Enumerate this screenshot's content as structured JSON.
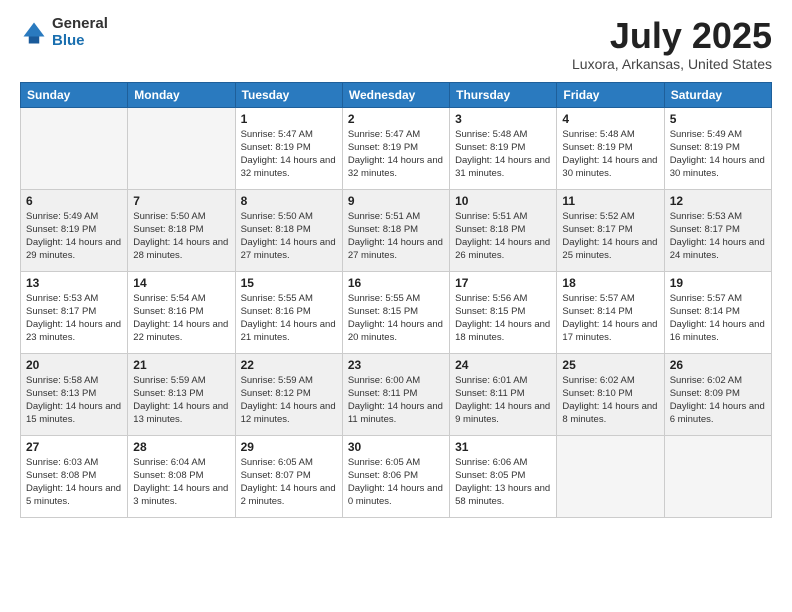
{
  "logo": {
    "general": "General",
    "blue": "Blue"
  },
  "title": "July 2025",
  "location": "Luxora, Arkansas, United States",
  "days_of_week": [
    "Sunday",
    "Monday",
    "Tuesday",
    "Wednesday",
    "Thursday",
    "Friday",
    "Saturday"
  ],
  "weeks": [
    [
      {
        "day": "",
        "info": ""
      },
      {
        "day": "",
        "info": ""
      },
      {
        "day": "1",
        "sunrise": "Sunrise: 5:47 AM",
        "sunset": "Sunset: 8:19 PM",
        "daylight": "Daylight: 14 hours and 32 minutes."
      },
      {
        "day": "2",
        "sunrise": "Sunrise: 5:47 AM",
        "sunset": "Sunset: 8:19 PM",
        "daylight": "Daylight: 14 hours and 32 minutes."
      },
      {
        "day": "3",
        "sunrise": "Sunrise: 5:48 AM",
        "sunset": "Sunset: 8:19 PM",
        "daylight": "Daylight: 14 hours and 31 minutes."
      },
      {
        "day": "4",
        "sunrise": "Sunrise: 5:48 AM",
        "sunset": "Sunset: 8:19 PM",
        "daylight": "Daylight: 14 hours and 30 minutes."
      },
      {
        "day": "5",
        "sunrise": "Sunrise: 5:49 AM",
        "sunset": "Sunset: 8:19 PM",
        "daylight": "Daylight: 14 hours and 30 minutes."
      }
    ],
    [
      {
        "day": "6",
        "sunrise": "Sunrise: 5:49 AM",
        "sunset": "Sunset: 8:19 PM",
        "daylight": "Daylight: 14 hours and 29 minutes."
      },
      {
        "day": "7",
        "sunrise": "Sunrise: 5:50 AM",
        "sunset": "Sunset: 8:18 PM",
        "daylight": "Daylight: 14 hours and 28 minutes."
      },
      {
        "day": "8",
        "sunrise": "Sunrise: 5:50 AM",
        "sunset": "Sunset: 8:18 PM",
        "daylight": "Daylight: 14 hours and 27 minutes."
      },
      {
        "day": "9",
        "sunrise": "Sunrise: 5:51 AM",
        "sunset": "Sunset: 8:18 PM",
        "daylight": "Daylight: 14 hours and 27 minutes."
      },
      {
        "day": "10",
        "sunrise": "Sunrise: 5:51 AM",
        "sunset": "Sunset: 8:18 PM",
        "daylight": "Daylight: 14 hours and 26 minutes."
      },
      {
        "day": "11",
        "sunrise": "Sunrise: 5:52 AM",
        "sunset": "Sunset: 8:17 PM",
        "daylight": "Daylight: 14 hours and 25 minutes."
      },
      {
        "day": "12",
        "sunrise": "Sunrise: 5:53 AM",
        "sunset": "Sunset: 8:17 PM",
        "daylight": "Daylight: 14 hours and 24 minutes."
      }
    ],
    [
      {
        "day": "13",
        "sunrise": "Sunrise: 5:53 AM",
        "sunset": "Sunset: 8:17 PM",
        "daylight": "Daylight: 14 hours and 23 minutes."
      },
      {
        "day": "14",
        "sunrise": "Sunrise: 5:54 AM",
        "sunset": "Sunset: 8:16 PM",
        "daylight": "Daylight: 14 hours and 22 minutes."
      },
      {
        "day": "15",
        "sunrise": "Sunrise: 5:55 AM",
        "sunset": "Sunset: 8:16 PM",
        "daylight": "Daylight: 14 hours and 21 minutes."
      },
      {
        "day": "16",
        "sunrise": "Sunrise: 5:55 AM",
        "sunset": "Sunset: 8:15 PM",
        "daylight": "Daylight: 14 hours and 20 minutes."
      },
      {
        "day": "17",
        "sunrise": "Sunrise: 5:56 AM",
        "sunset": "Sunset: 8:15 PM",
        "daylight": "Daylight: 14 hours and 18 minutes."
      },
      {
        "day": "18",
        "sunrise": "Sunrise: 5:57 AM",
        "sunset": "Sunset: 8:14 PM",
        "daylight": "Daylight: 14 hours and 17 minutes."
      },
      {
        "day": "19",
        "sunrise": "Sunrise: 5:57 AM",
        "sunset": "Sunset: 8:14 PM",
        "daylight": "Daylight: 14 hours and 16 minutes."
      }
    ],
    [
      {
        "day": "20",
        "sunrise": "Sunrise: 5:58 AM",
        "sunset": "Sunset: 8:13 PM",
        "daylight": "Daylight: 14 hours and 15 minutes."
      },
      {
        "day": "21",
        "sunrise": "Sunrise: 5:59 AM",
        "sunset": "Sunset: 8:13 PM",
        "daylight": "Daylight: 14 hours and 13 minutes."
      },
      {
        "day": "22",
        "sunrise": "Sunrise: 5:59 AM",
        "sunset": "Sunset: 8:12 PM",
        "daylight": "Daylight: 14 hours and 12 minutes."
      },
      {
        "day": "23",
        "sunrise": "Sunrise: 6:00 AM",
        "sunset": "Sunset: 8:11 PM",
        "daylight": "Daylight: 14 hours and 11 minutes."
      },
      {
        "day": "24",
        "sunrise": "Sunrise: 6:01 AM",
        "sunset": "Sunset: 8:11 PM",
        "daylight": "Daylight: 14 hours and 9 minutes."
      },
      {
        "day": "25",
        "sunrise": "Sunrise: 6:02 AM",
        "sunset": "Sunset: 8:10 PM",
        "daylight": "Daylight: 14 hours and 8 minutes."
      },
      {
        "day": "26",
        "sunrise": "Sunrise: 6:02 AM",
        "sunset": "Sunset: 8:09 PM",
        "daylight": "Daylight: 14 hours and 6 minutes."
      }
    ],
    [
      {
        "day": "27",
        "sunrise": "Sunrise: 6:03 AM",
        "sunset": "Sunset: 8:08 PM",
        "daylight": "Daylight: 14 hours and 5 minutes."
      },
      {
        "day": "28",
        "sunrise": "Sunrise: 6:04 AM",
        "sunset": "Sunset: 8:08 PM",
        "daylight": "Daylight: 14 hours and 3 minutes."
      },
      {
        "day": "29",
        "sunrise": "Sunrise: 6:05 AM",
        "sunset": "Sunset: 8:07 PM",
        "daylight": "Daylight: 14 hours and 2 minutes."
      },
      {
        "day": "30",
        "sunrise": "Sunrise: 6:05 AM",
        "sunset": "Sunset: 8:06 PM",
        "daylight": "Daylight: 14 hours and 0 minutes."
      },
      {
        "day": "31",
        "sunrise": "Sunrise: 6:06 AM",
        "sunset": "Sunset: 8:05 PM",
        "daylight": "Daylight: 13 hours and 58 minutes."
      },
      {
        "day": "",
        "info": ""
      },
      {
        "day": "",
        "info": ""
      }
    ]
  ]
}
